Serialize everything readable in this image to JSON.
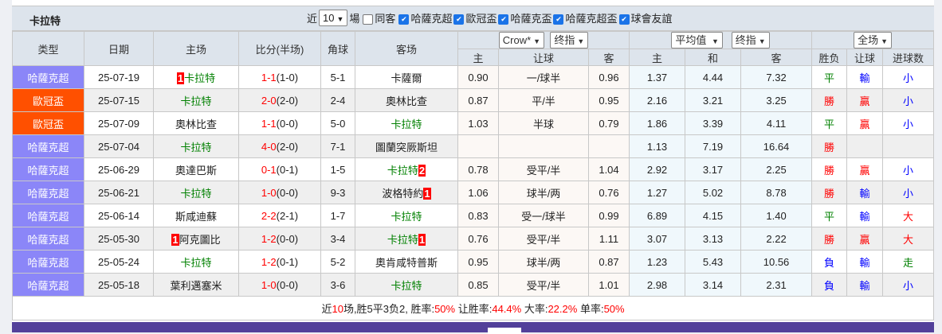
{
  "header": {
    "team": "卡拉特",
    "recent_label": "近",
    "recent_count": "10",
    "games_label": "場",
    "filters": [
      {
        "label": "同客",
        "checked": false
      },
      {
        "label": "哈薩克超",
        "checked": true
      },
      {
        "label": "歐冠盃",
        "checked": true
      },
      {
        "label": "哈薩克盃",
        "checked": true
      },
      {
        "label": "哈薩克超盃",
        "checked": true
      },
      {
        "label": "球會友誼",
        "checked": true
      }
    ]
  },
  "columns": {
    "type": "类型",
    "date": "日期",
    "home": "主场",
    "score": "比分(半场)",
    "corner": "角球",
    "away": "客场",
    "company": "Crow*",
    "company_mode": "终指",
    "avg": "平均值",
    "avg_mode": "终指",
    "scope": "全场",
    "sub": [
      "主",
      "让球",
      "客",
      "主",
      "和",
      "客",
      "胜负",
      "让球",
      "进球数"
    ]
  },
  "colors": {
    "league_kzp": "#8b86f8",
    "league_ucl": "#ff5000",
    "win": "#ff0000",
    "draw": "#008000",
    "loss": "#0000ff"
  },
  "rows": [
    {
      "type": "哈薩克超",
      "tc": "#8b86f8",
      "date": "25-07-19",
      "hrank": "1",
      "home": "卡拉特",
      "hg": true,
      "s1": "1-1",
      "ht": "(1-0)",
      "corner": "5-1",
      "away": "卡薩爾",
      "ag": false,
      "arank": "",
      "o": [
        "0.90",
        "一/球半",
        "0.96"
      ],
      "a": [
        "1.37",
        "4.44",
        "7.32"
      ],
      "r": [
        "平",
        "輸",
        "小"
      ],
      "rc": [
        "green",
        "blue",
        "blue"
      ]
    },
    {
      "type": "歐冠盃",
      "tc": "#ff5000",
      "date": "25-07-15",
      "hrank": "",
      "home": "卡拉特",
      "hg": true,
      "s1": "2-0",
      "ht": "(2-0)",
      "corner": "2-4",
      "away": "奧林比查",
      "ag": false,
      "arank": "",
      "o": [
        "0.87",
        "平/半",
        "0.95"
      ],
      "a": [
        "2.16",
        "3.21",
        "3.25"
      ],
      "r": [
        "勝",
        "贏",
        "小"
      ],
      "rc": [
        "red",
        "red",
        "blue"
      ]
    },
    {
      "type": "歐冠盃",
      "tc": "#ff5000",
      "date": "25-07-09",
      "hrank": "",
      "home": "奧林比查",
      "hg": false,
      "s1": "1-1",
      "ht": "(0-0)",
      "corner": "5-0",
      "away": "卡拉特",
      "ag": true,
      "arank": "",
      "o": [
        "1.03",
        "半球",
        "0.79"
      ],
      "a": [
        "1.86",
        "3.39",
        "4.11"
      ],
      "r": [
        "平",
        "贏",
        "小"
      ],
      "rc": [
        "green",
        "red",
        "blue"
      ]
    },
    {
      "type": "哈薩克超",
      "tc": "#8b86f8",
      "date": "25-07-04",
      "hrank": "",
      "home": "卡拉特",
      "hg": true,
      "s1": "4-0",
      "ht": "(2-0)",
      "corner": "7-1",
      "away": "圖蘭突厥斯坦",
      "ag": false,
      "arank": "",
      "o": [
        "",
        "",
        ""
      ],
      "a": [
        "1.13",
        "7.19",
        "16.64"
      ],
      "r": [
        "勝",
        "",
        ""
      ],
      "rc": [
        "red",
        "blue",
        "blue"
      ]
    },
    {
      "type": "哈薩克超",
      "tc": "#8b86f8",
      "date": "25-06-29",
      "hrank": "",
      "home": "奧達巴斯",
      "hg": false,
      "s1": "0-1",
      "ht": "(0-1)",
      "corner": "1-5",
      "away": "卡拉特",
      "ag": true,
      "arank": "2",
      "o": [
        "0.78",
        "受平/半",
        "1.04"
      ],
      "a": [
        "2.92",
        "3.17",
        "2.25"
      ],
      "r": [
        "勝",
        "贏",
        "小"
      ],
      "rc": [
        "red",
        "red",
        "blue"
      ]
    },
    {
      "type": "哈薩克超",
      "tc": "#8b86f8",
      "date": "25-06-21",
      "hrank": "",
      "home": "卡拉特",
      "hg": true,
      "s1": "1-0",
      "ht": "(0-0)",
      "corner": "9-3",
      "away": "波格特約",
      "ag": false,
      "arank": "1",
      "o": [
        "1.06",
        "球半/两",
        "0.76"
      ],
      "a": [
        "1.27",
        "5.02",
        "8.78"
      ],
      "r": [
        "勝",
        "輸",
        "小"
      ],
      "rc": [
        "red",
        "blue",
        "blue"
      ]
    },
    {
      "type": "哈薩克超",
      "tc": "#8b86f8",
      "date": "25-06-14",
      "hrank": "",
      "home": "斯咸迪蘇",
      "hg": false,
      "s1": "2-2",
      "ht": "(2-1)",
      "corner": "1-7",
      "away": "卡拉特",
      "ag": true,
      "arank": "",
      "o": [
        "0.83",
        "受一/球半",
        "0.99"
      ],
      "a": [
        "6.89",
        "4.15",
        "1.40"
      ],
      "r": [
        "平",
        "輸",
        "大"
      ],
      "rc": [
        "green",
        "blue",
        "red"
      ]
    },
    {
      "type": "哈薩克超",
      "tc": "#8b86f8",
      "date": "25-05-30",
      "hrank": "1",
      "home": "阿克圖比",
      "hg": false,
      "s1": "1-2",
      "ht": "(0-0)",
      "corner": "3-4",
      "away": "卡拉特",
      "ag": true,
      "arank": "1",
      "o": [
        "0.76",
        "受平/半",
        "1.11"
      ],
      "a": [
        "3.07",
        "3.13",
        "2.22"
      ],
      "r": [
        "勝",
        "贏",
        "大"
      ],
      "rc": [
        "red",
        "red",
        "red"
      ]
    },
    {
      "type": "哈薩克超",
      "tc": "#8b86f8",
      "date": "25-05-24",
      "hrank": "",
      "home": "卡拉特",
      "hg": true,
      "s1": "1-2",
      "ht": "(0-1)",
      "corner": "5-2",
      "away": "奧肯咸特普斯",
      "ag": false,
      "arank": "",
      "o": [
        "0.95",
        "球半/两",
        "0.87"
      ],
      "a": [
        "1.23",
        "5.43",
        "10.56"
      ],
      "r": [
        "負",
        "輸",
        "走"
      ],
      "rc": [
        "blue",
        "blue",
        "green"
      ]
    },
    {
      "type": "哈薩克超",
      "tc": "#8b86f8",
      "date": "25-05-18",
      "hrank": "",
      "home": "葉利邁塞米",
      "hg": false,
      "s1": "1-0",
      "ht": "(0-0)",
      "corner": "3-6",
      "away": "卡拉特",
      "ag": true,
      "arank": "",
      "o": [
        "0.85",
        "受平/半",
        "1.01"
      ],
      "a": [
        "2.98",
        "3.14",
        "2.31"
      ],
      "r": [
        "負",
        "輸",
        "小"
      ],
      "rc": [
        "blue",
        "blue",
        "blue"
      ]
    }
  ],
  "summary": {
    "p1": "近",
    "games": "10",
    "p2": "场,胜5平3负2, 胜率:",
    "win_rate": "50%",
    "p3": " 让胜率:",
    "hcap_rate": "44.4%",
    "p4": " 大率:",
    "over_rate": "22.2%",
    "p5": " 单率:",
    "odd_rate": "50%"
  }
}
